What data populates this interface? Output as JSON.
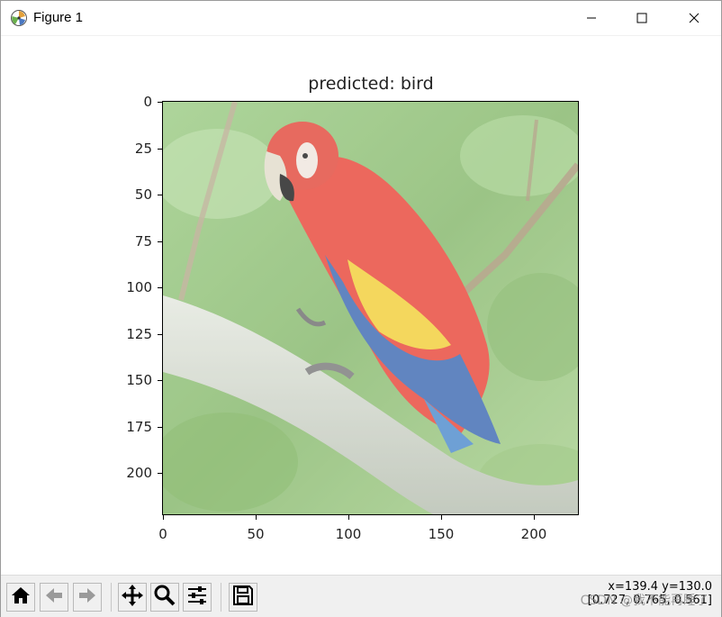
{
  "window": {
    "title": "Figure 1",
    "icons": {
      "app": "matplotlib-logo-icon",
      "minimize": "minimize-icon",
      "maximize": "maximize-icon",
      "close": "close-icon"
    }
  },
  "plot": {
    "title": "predicted: bird",
    "image_description": "",
    "yticks": [
      "0",
      "25",
      "50",
      "75",
      "100",
      "125",
      "150",
      "175",
      "200"
    ],
    "xticks": [
      "0",
      "50",
      "100",
      "150",
      "200"
    ]
  },
  "toolbar": {
    "buttons": [
      "home-icon",
      "back-icon",
      "forward-icon",
      "pan-icon",
      "zoom-icon",
      "configure-subplots-icon",
      "save-icon"
    ],
    "coords_line1": "x=139.4  y=130.0",
    "coords_line2": "[0.727, 0.765, 0.561]",
    "watermark": "CSDN @我不能再睡了"
  },
  "colors": {
    "toolbar_bg": "#f0f0f0",
    "foliage": "#8fbf72",
    "parrot_red": "#e8473a",
    "parrot_yellow": "#f2cf3a",
    "parrot_blue": "#3f6bb3",
    "branch": "#cdd3c8"
  }
}
